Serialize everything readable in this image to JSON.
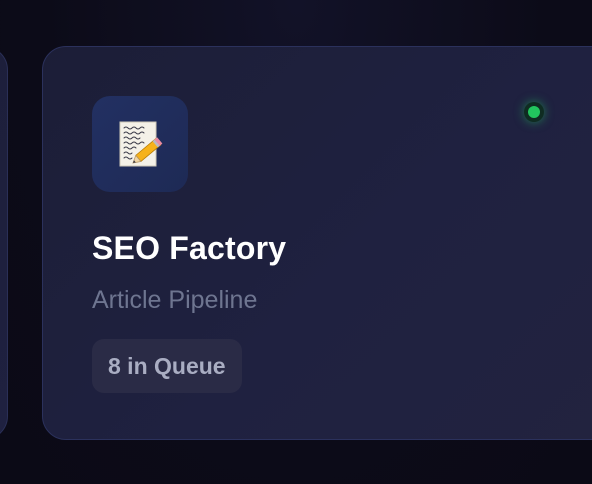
{
  "card": {
    "icon": "memo-with-pencil-icon",
    "title": "SEO Factory",
    "subtitle": "Article Pipeline",
    "queue_badge": "8 in Queue",
    "status": "online",
    "status_color": "#22c55e"
  },
  "colors": {
    "background": "#0d0c1a",
    "card_background": "#1f2140",
    "card_border": "#2b315c",
    "icon_tile": "#223062",
    "subtitle_text": "#6e7590",
    "badge_background": "#2a2b46",
    "badge_text": "#a9adc2"
  }
}
